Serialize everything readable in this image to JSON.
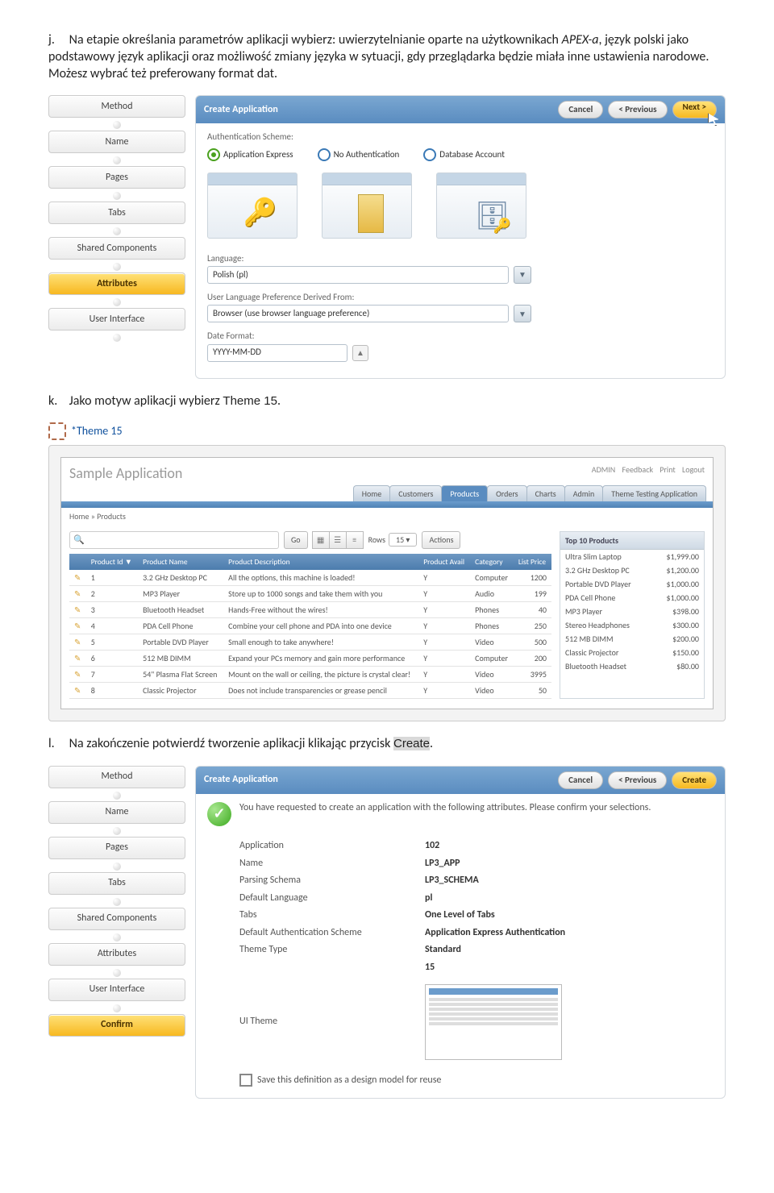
{
  "para_j": {
    "letter": "j.",
    "text_a": "Na etapie określania parametrów aplikacji wybierz: uwierzytelnianie oparte na użytkownikach ",
    "em": "APEX-a",
    "text_b": ", język polski jako podstawowy język aplikacji oraz możliwość zmiany języka w sytuacji, gdy przeglądarka będzie miała inne ustawienia narodowe. Możesz wybrać też preferowany format dat."
  },
  "para_k": {
    "letter": "k.",
    "text": "Jako motyw aplikacji wybierz ",
    "theme": "Theme 15",
    "dot": "."
  },
  "para_l": {
    "letter": "l.",
    "text": "Na zakończenie potwierdź tworzenie aplikacji klikając przycisk ",
    "btn": "Create",
    "dot": "."
  },
  "steps": [
    "Method",
    "Name",
    "Pages",
    "Tabs",
    "Shared Components",
    "Attributes",
    "User Interface",
    "Confirm"
  ],
  "panelTitle": "Create Application",
  "btns": {
    "cancel": "Cancel",
    "prev": "< Previous",
    "next": "Next >",
    "create": "Create"
  },
  "auth": {
    "label": "Authentication Scheme:",
    "o1": "Application Express",
    "o2": "No Authentication",
    "o3": "Database Account"
  },
  "lang": {
    "label": "Language:",
    "value": "Polish (pl)"
  },
  "pref": {
    "label": "User Language Preference Derived From:",
    "value": "Browser (use browser language preference)"
  },
  "datefmt": {
    "label": "Date Format:",
    "value": "YYYY-MM-DD"
  },
  "theme15": "*Theme 15",
  "sample": {
    "title": "Sample Application",
    "userlinks": [
      "ADMIN",
      "Feedback",
      "Print",
      "Logout"
    ],
    "tabs": [
      "Home",
      "Customers",
      "Products",
      "Orders",
      "Charts",
      "Admin",
      "Theme Testing Application"
    ],
    "crumb": "Home » Products",
    "go": "Go",
    "rowslbl": "Rows",
    "rowsval": "15",
    "actions": "Actions",
    "cols": [
      "Product Id ▼",
      "Product Name",
      "Product Description",
      "Product Avail",
      "Category",
      "List Price"
    ],
    "rows": [
      [
        "1",
        "3.2 GHz Desktop PC",
        "All the options, this machine is loaded!",
        "Y",
        "Computer",
        "1200"
      ],
      [
        "2",
        "MP3 Player",
        "Store up to 1000 songs and take them with you",
        "Y",
        "Audio",
        "199"
      ],
      [
        "3",
        "Bluetooth Headset",
        "Hands-Free without the wires!",
        "Y",
        "Phones",
        "40"
      ],
      [
        "4",
        "PDA Cell Phone",
        "Combine your cell phone and PDA into one device",
        "Y",
        "Phones",
        "250"
      ],
      [
        "5",
        "Portable DVD Player",
        "Small enough to take anywhere!",
        "Y",
        "Video",
        "500"
      ],
      [
        "6",
        "512 MB DIMM",
        "Expand your PCs memory and gain more performance",
        "Y",
        "Computer",
        "200"
      ],
      [
        "7",
        "54\" Plasma Flat Screen",
        "Mount on the wall or ceiling, the picture is crystal clear!",
        "Y",
        "Video",
        "3995"
      ],
      [
        "8",
        "Classic Projector",
        "Does not include transparencies or grease pencil",
        "Y",
        "Video",
        "50"
      ]
    ],
    "top": {
      "title": "Top 10 Products",
      "items": [
        [
          "Ultra Slim Laptop",
          "$1,999.00"
        ],
        [
          "3.2 GHz Desktop PC",
          "$1,200.00"
        ],
        [
          "Portable DVD Player",
          "$1,000.00"
        ],
        [
          "PDA Cell Phone",
          "$1,000.00"
        ],
        [
          "MP3 Player",
          "$398.00"
        ],
        [
          "Stereo Headphones",
          "$300.00"
        ],
        [
          "512 MB DIMM",
          "$200.00"
        ],
        [
          "Classic Projector",
          "$150.00"
        ],
        [
          "Bluetooth Headset",
          "$80.00"
        ]
      ]
    }
  },
  "confirm": {
    "msg": "You have requested to create an application with the following attributes. Please confirm your selections.",
    "kv": [
      [
        "Application",
        "102"
      ],
      [
        "Name",
        "LP3_APP"
      ],
      [
        "Parsing Schema",
        "LP3_SCHEMA"
      ],
      [
        "Default Language",
        "pl"
      ],
      [
        "Tabs",
        "One Level of Tabs"
      ],
      [
        "Default Authentication Scheme",
        "Application Express Authentication"
      ],
      [
        "Theme Type",
        "Standard"
      ],
      [
        "",
        "15"
      ]
    ],
    "uitheme": "UI Theme",
    "save": "Save this definition as a design model for reuse"
  }
}
